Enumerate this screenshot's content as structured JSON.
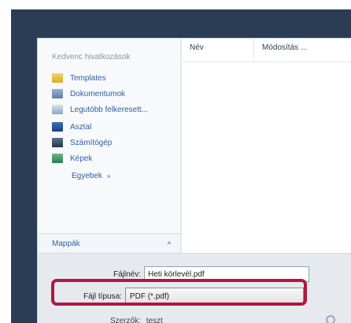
{
  "nav": {
    "header": "Kedvenc hivatkozások",
    "items": [
      {
        "label": "Templates",
        "icon": "folder-icon"
      },
      {
        "label": "Dokumentumok",
        "icon": "documents-icon"
      },
      {
        "label": "Legutóbb felkeresett...",
        "icon": "recent-places-icon"
      },
      {
        "label": "Asztal",
        "icon": "desktop-icon"
      },
      {
        "label": "Számítógép",
        "icon": "computer-icon"
      },
      {
        "label": "Képek",
        "icon": "pictures-icon"
      }
    ],
    "more_label": "Egyebek",
    "more_chevron": "»"
  },
  "folders_bar": {
    "label": "Mappák",
    "toggle": "^"
  },
  "columns": {
    "name": "Név",
    "modified": "Módosítás ..."
  },
  "form": {
    "filename_label": "Fájlnév:",
    "filename_value": "Heti körlevél.pdf",
    "filetype_label": "Fájl típusa:",
    "filetype_value": "PDF (*.pdf)",
    "author_label": "Szerzők:",
    "author_value": "teszt"
  },
  "colors": {
    "background_dark": "#2b3d55",
    "highlight": "#b2183d",
    "link": "#2f5fa3"
  }
}
